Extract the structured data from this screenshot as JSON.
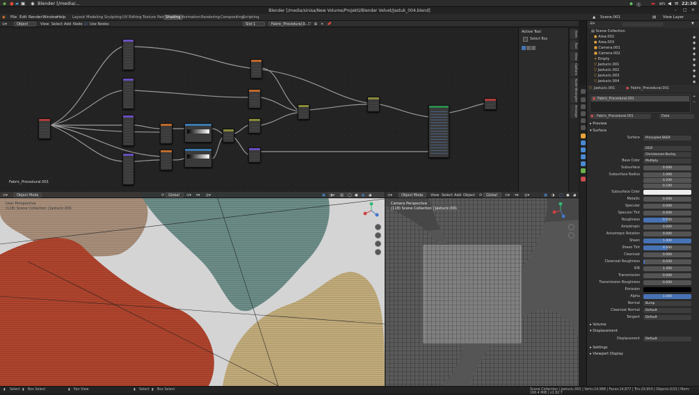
{
  "system": {
    "app_title": "Blender [/media/...",
    "clock": "22:36",
    "keyboard": "en",
    "menu_icon": "app-launcher-icon"
  },
  "window": {
    "title": "Blender [/media/sinisa/New Volume/Projekti/Blender Velvet/Jastuk_004.blend]"
  },
  "menubar": {
    "items": [
      "File",
      "Edit",
      "Render",
      "Window",
      "Help"
    ],
    "workspaces": [
      "Layout",
      "Modeling",
      "Sculpting",
      "UV Editing",
      "Texture Paint",
      "Shading",
      "Animation",
      "Rendering",
      "Compositing",
      "Scripting"
    ],
    "active_workspace": "Shading",
    "scene": "Scene.001",
    "view_layer": "View Layer"
  },
  "node_editor": {
    "header": {
      "mode": "Object",
      "menus": [
        "View",
        "Select",
        "Add",
        "Node"
      ],
      "use_nodes": "Use Nodes",
      "slot": "Slot 1",
      "material": "Fabric_Procedural.0..."
    },
    "material_label": "Fabric_Procedural.001",
    "side_panel": {
      "title": "Active Tool",
      "tool": "Select Box"
    },
    "tabs": [
      "Item",
      "Tool",
      "View",
      "Options",
      "Node Wrangler",
      "Arrange"
    ]
  },
  "outliner": {
    "collection": "Scene Collection",
    "items": [
      "Area.002",
      "Area.003",
      "Camera.001",
      "Camera.002",
      "Empty",
      "Jastucic.001",
      "Jastucic.002",
      "Jastucic.003",
      "Jastucic.004"
    ]
  },
  "properties": {
    "object": "Jastucic.001",
    "material": "Fabric_Procedural.001",
    "slot_material": "Fabric_Procedural.001",
    "material_field": "Fabric_Procedural.001",
    "data_dropdown": "Data",
    "sections": {
      "preview": "Preview",
      "surface": "Surface",
      "volume": "Volume",
      "displacement": "Displacement",
      "settings": "Settings",
      "viewport_display": "Viewport Display"
    },
    "surface_shader": "Principled BSDF",
    "distribution": "GGX",
    "subsurface_method": "Christensen-Burley",
    "params": [
      {
        "label": "Base Color",
        "value": "Multiply"
      },
      {
        "label": "Subsurface",
        "value": "0.000"
      },
      {
        "label": "Subsurface Radius",
        "value": "1.000"
      },
      {
        "label": "",
        "value": "0.200"
      },
      {
        "label": "",
        "value": "0.100"
      },
      {
        "label": "Subsurface Color",
        "value": ""
      },
      {
        "label": "Metallic",
        "value": "0.000"
      },
      {
        "label": "Specular",
        "value": "0.000"
      },
      {
        "label": "Specular Tint",
        "value": "0.000"
      },
      {
        "label": "Roughness",
        "value": "0.500"
      },
      {
        "label": "Anisotropic",
        "value": "0.000"
      },
      {
        "label": "Anisotropic Rotation",
        "value": "0.000"
      },
      {
        "label": "Sheen",
        "value": "1.000"
      },
      {
        "label": "Sheen Tint",
        "value": "0.500"
      },
      {
        "label": "Clearcoat",
        "value": "0.000"
      },
      {
        "label": "Clearcoat Roughness",
        "value": "0.030"
      },
      {
        "label": "IOR",
        "value": "1.450"
      },
      {
        "label": "Transmission",
        "value": "0.000"
      },
      {
        "label": "Transmission Roughness",
        "value": "0.000"
      },
      {
        "label": "Emission",
        "value": ""
      },
      {
        "label": "Alpha",
        "value": "1.000"
      },
      {
        "label": "Normal",
        "value": "Bump"
      },
      {
        "label": "Clearcoat Normal",
        "value": "Default"
      },
      {
        "label": "Tangent",
        "value": "Default"
      }
    ],
    "displacement_label": "Displacement",
    "displacement_value": "Default"
  },
  "viewport_left": {
    "mode": "Object Mode",
    "menus": [
      "View",
      "Select",
      "Add",
      "Object"
    ],
    "orientation": "Global",
    "view_name": "User Perspective",
    "collection_info": "(118) Scene Collection | Jastucic.001"
  },
  "viewport_right": {
    "mode": "Object Mode",
    "menus": [
      "View",
      "Select",
      "Add",
      "Object"
    ],
    "orientation": "Global",
    "view_name": "Camera Perspective",
    "collection_info": "(118) Scene Collection | Jastucic.001"
  },
  "statusbar": {
    "left": [
      "Select",
      "Box Select",
      "Pan View",
      "Select",
      "Box Select"
    ],
    "stats": "Scene Collection | Jastucic.001 | Verts:14,988 | Faces:14,877 | Tris:29,954 | Objects:0/10 | Mem: 166.4 MiB | v2.82.7"
  },
  "colors": {
    "accent": "#4772b3",
    "active_node_header": "#2e8a4d",
    "bg": "#232323"
  }
}
